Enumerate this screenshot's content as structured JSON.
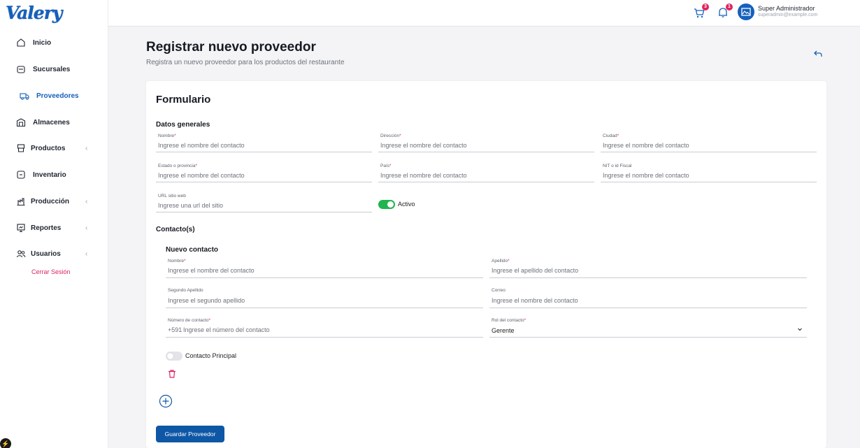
{
  "app": {
    "logo_text": "Valery"
  },
  "sidebar": {
    "items": [
      {
        "label": "Inicio",
        "icon": "home-icon",
        "has_submenu": false,
        "active": false
      },
      {
        "label": "Sucursales",
        "icon": "store-icon",
        "has_submenu": false,
        "active": false
      },
      {
        "label": "Proveedores",
        "icon": "truck-icon",
        "has_submenu": false,
        "active": true
      },
      {
        "label": "Almacenes",
        "icon": "warehouse-icon",
        "has_submenu": false,
        "active": false
      },
      {
        "label": "Productos",
        "icon": "box-icon",
        "has_submenu": true,
        "active": false
      },
      {
        "label": "Inventario",
        "icon": "inventory-icon",
        "has_submenu": false,
        "active": false
      },
      {
        "label": "Producción",
        "icon": "factory-icon",
        "has_submenu": true,
        "active": false
      },
      {
        "label": "Reportes",
        "icon": "report-icon",
        "has_submenu": true,
        "active": false
      },
      {
        "label": "Usuarios",
        "icon": "users-icon",
        "has_submenu": true,
        "active": false
      }
    ],
    "logout_label": "Cerrar Sesión",
    "chevron": "‹"
  },
  "topbar": {
    "cart_badge": "3",
    "notifications_badge": "1",
    "user_name": "Super Administrador",
    "user_email": "superadmin@example.com"
  },
  "header": {
    "title": "Registrar nuevo proveedor",
    "subtitle": "Registra un nuevo proveedor para los productos del restaurante"
  },
  "form": {
    "title": "Formulario",
    "general_section": "Datos generales",
    "general_fields": {
      "nombre": {
        "label": "Nombre",
        "required": "*",
        "placeholder": "Ingrese el nombre del contacto"
      },
      "direccion": {
        "label": "Dirección",
        "required": "*",
        "placeholder": "Ingrese el nombre del contacto"
      },
      "ciudad": {
        "label": "Ciudad",
        "required": "*",
        "placeholder": "Ingrese el nombre del contacto"
      },
      "estado": {
        "label": "Estado o provincia",
        "required": "*",
        "placeholder": "Ingrese el nombre del contacto"
      },
      "pais": {
        "label": "País",
        "required": "*",
        "placeholder": "Ingrese el nombre del contacto"
      },
      "nit": {
        "label": "NIT o id Fiscal",
        "placeholder": "Ingrese el nombre del contacto"
      },
      "url": {
        "label": "URL sitio web",
        "placeholder": "Ingrese una url del sitio"
      }
    },
    "active_toggle": {
      "label": "Activo",
      "on": true
    },
    "contacts_section": "Contacto(s)",
    "new_contact": {
      "title": "Nuevo contacto",
      "nombre": {
        "label": "Nombre",
        "required": "*",
        "placeholder": "Ingrese el nombre del contacto"
      },
      "apellido": {
        "label": "Apellido",
        "required": "*",
        "placeholder": "Ingrese el apellido del contacto"
      },
      "segundo_apellido": {
        "label": "Segundo Apellido",
        "placeholder": "Ingrese el segundo apellido"
      },
      "correo": {
        "label": "Correo",
        "placeholder": "Ingrese el nombre del contacto"
      },
      "telefono": {
        "label": "Número de contacto",
        "required": "*",
        "prefix": "+591",
        "placeholder": "Ingrese el número del contacto"
      },
      "rol": {
        "label": "Rol del contacto",
        "required": "*",
        "value": "Gerente"
      },
      "principal_toggle": {
        "label": "Contacto Principal",
        "on": false
      }
    },
    "save_button": "Guardar Proveedor"
  },
  "colors": {
    "primary": "#1560bd",
    "button": "#0e57a6",
    "accent_red": "#e0245e",
    "toggle_on": "#20b550"
  }
}
